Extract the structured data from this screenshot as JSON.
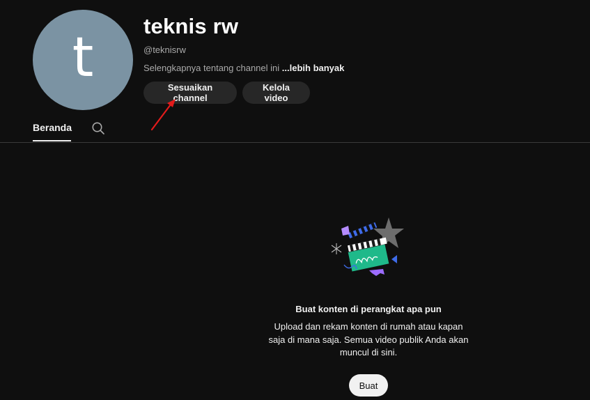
{
  "channel": {
    "avatar_letter": "t",
    "avatar_color": "#7b93a3",
    "name": "teknis rw",
    "handle": "@teknisrw",
    "about_text": "Selengkapnya tentang channel ini",
    "about_more": "...lebih banyak"
  },
  "actions": {
    "customize_label": "Sesuaikan channel",
    "manage_label": "Kelola video"
  },
  "tabs": [
    {
      "label": "Beranda",
      "active": true
    },
    {
      "icon": "search-icon"
    }
  ],
  "annotation": {
    "arrow_color": "#e31b1b"
  },
  "empty_state": {
    "illustration": "clapperboard-illustration",
    "title": "Buat konten di perangkat apa pun",
    "description": "Upload dan rekam konten di rumah atau kapan saja di mana saja. Semua video publik Anda akan muncul di sini.",
    "create_label": "Buat"
  },
  "theme": {
    "background": "#0f0f0f",
    "button_bg": "#272727",
    "text_primary": "#f1f1f1",
    "text_secondary": "#aaaaaa"
  }
}
